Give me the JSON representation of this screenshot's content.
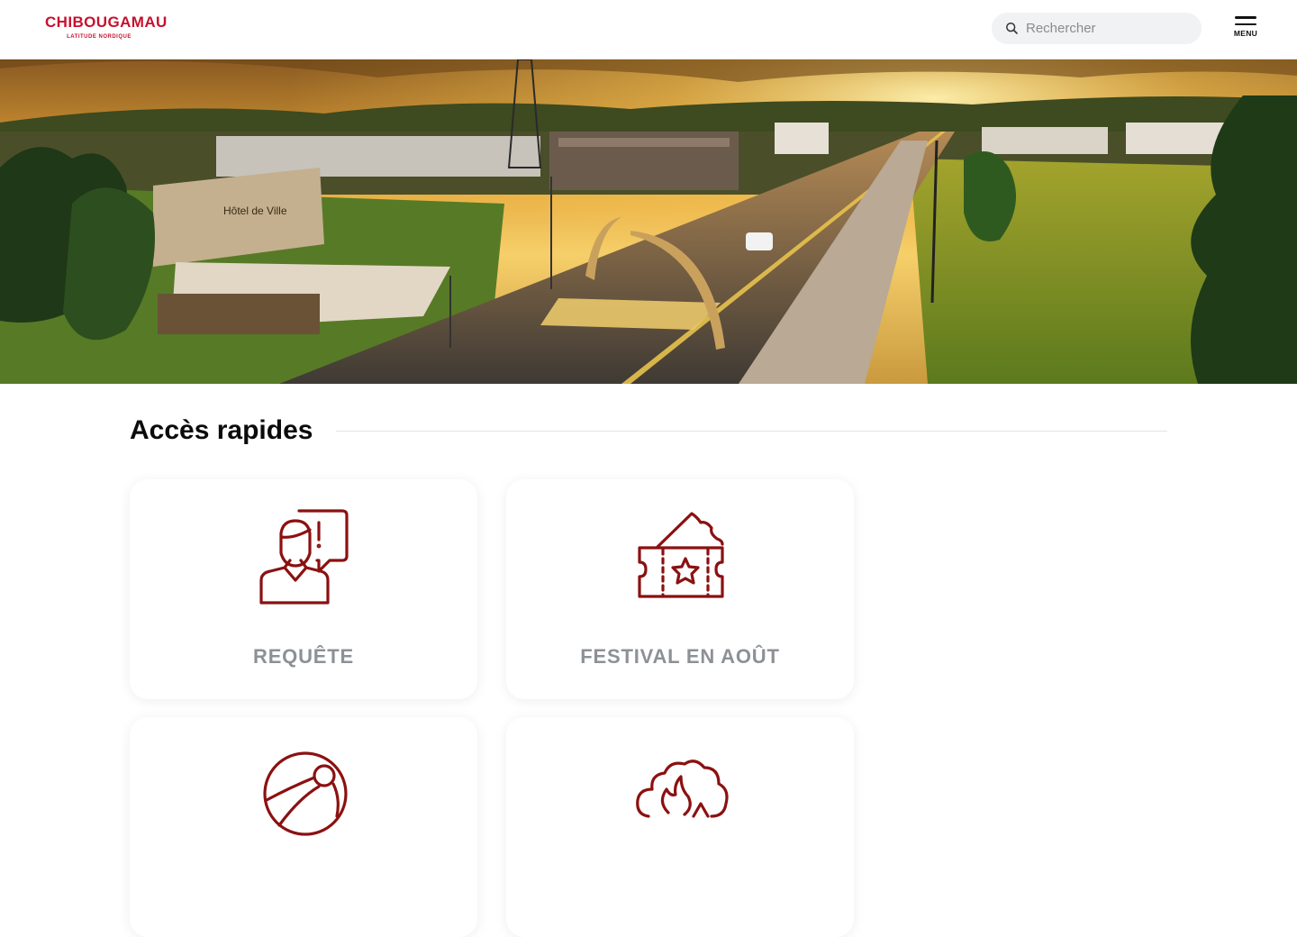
{
  "header": {
    "logo": {
      "name": "CHIBOUGAMAU",
      "tagline": "LATITUDE NORDIQUE"
    },
    "search": {
      "placeholder": "Rechercher",
      "value": ""
    },
    "menu_label": "MENU"
  },
  "hero": {
    "sign_text": "Hôtel de Ville"
  },
  "quick_access": {
    "title": "Accès rapides",
    "cards": [
      {
        "label": "REQUÊTE",
        "icon": "person-speech-exclamation-icon"
      },
      {
        "label": "FESTIVAL EN AOÛT",
        "icon": "festival-ticket-icon"
      },
      {
        "label": "",
        "icon": "beach-ball-icon"
      },
      {
        "label": "",
        "icon": "fire-campfire-icon"
      }
    ]
  },
  "colors": {
    "brand": "#c8102e",
    "icon": "#8b1111",
    "card_label": "#8d9196"
  }
}
